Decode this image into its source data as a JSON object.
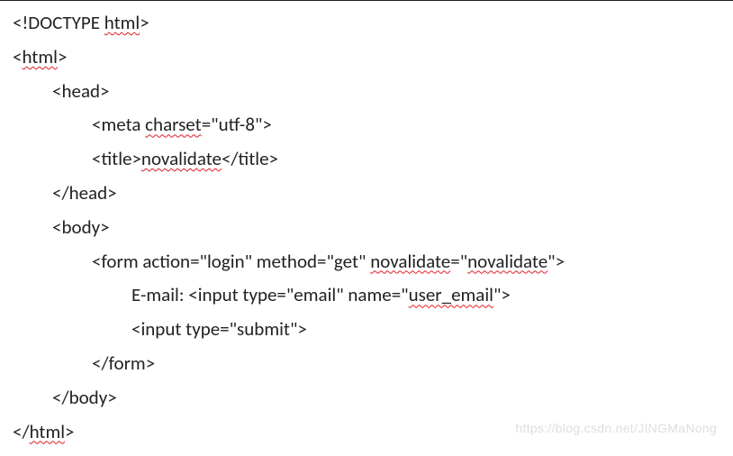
{
  "code": {
    "l01_a": "<!DOCTYPE ",
    "l01_b": "html",
    "l01_c": ">",
    "l02_a": "<",
    "l02_b": "html",
    "l02_c": ">",
    "l03": "<head>",
    "l04_a": "<meta ",
    "l04_b": "charset",
    "l04_c": "=\"utf-8\">",
    "l05_a": "<title>",
    "l05_b": "novalidate",
    "l05_c": "</title>",
    "l06": "</head>",
    "l07": "<body>",
    "l08_a": "<form action=\"login\" method=\"get\" ",
    "l08_b": "novalidate",
    "l08_c": "=\"",
    "l08_d": "novalidate",
    "l08_e": "\">",
    "l09_a": "E-mail: <input type=\"email\" name=\"",
    "l09_b": "user_email",
    "l09_c": "\">",
    "l10": "<input type=\"submit\">",
    "l11": "</form>",
    "l12": "</body>",
    "l13_a": "</",
    "l13_b": "html",
    "l13_c": ">"
  },
  "watermark": "https://blog.csdn.net/JINGMaNong"
}
